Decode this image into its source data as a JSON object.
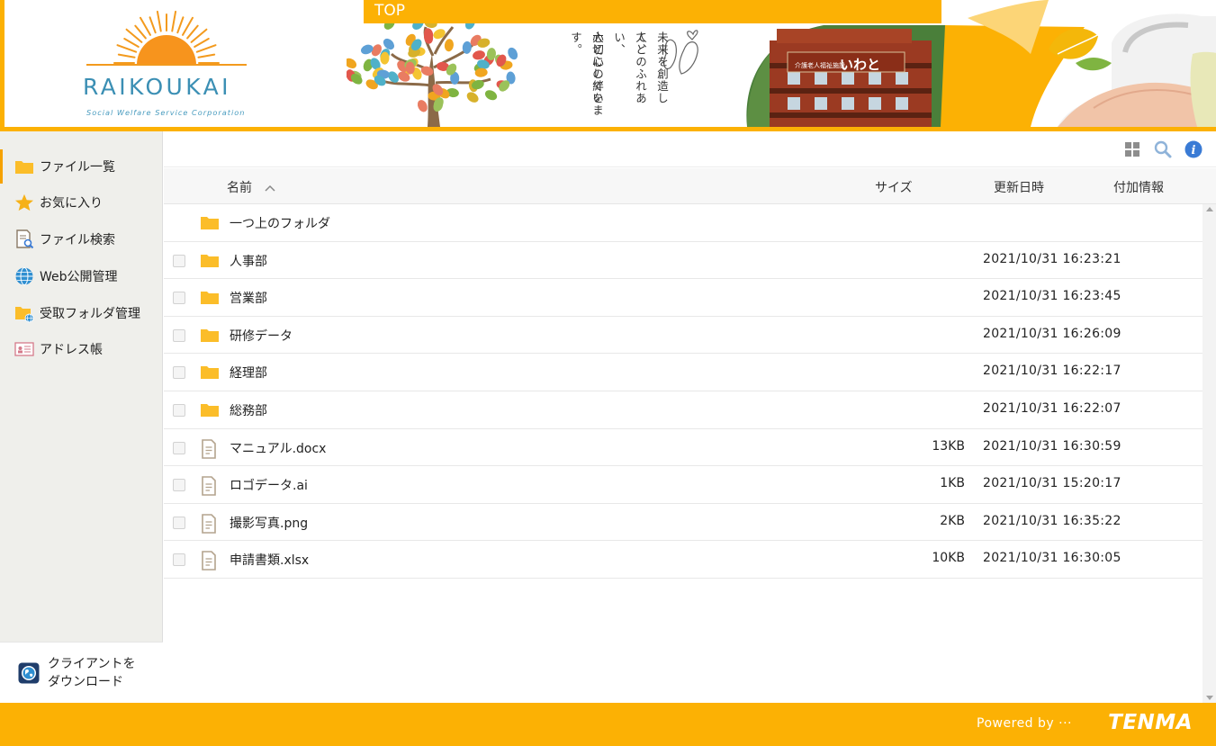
{
  "header": {
    "logo_text": "RAIKOUKAI",
    "logo_subtitle": "Social Welfare Service Corporation",
    "top_label": "TOP",
    "banner_lines": [
      "未来を創造して、",
      "人とのふれあい、",
      "心と心の絆を",
      "大切にしています。"
    ],
    "building_sign": "いわと",
    "building_sign_small": "介護老人福祉施設"
  },
  "sidebar": {
    "items": [
      {
        "label": "ファイル一覧",
        "icon": "folder-icon"
      },
      {
        "label": "お気に入り",
        "icon": "star-icon"
      },
      {
        "label": "ファイル検索",
        "icon": "file-search-icon"
      },
      {
        "label": "Web公開管理",
        "icon": "globe-icon"
      },
      {
        "label": "受取フォルダ管理",
        "icon": "folder-globe-icon"
      },
      {
        "label": "アドレス帳",
        "icon": "address-card-icon"
      }
    ],
    "client_download": {
      "line1": "クライアントを",
      "line2": "ダウンロード"
    }
  },
  "list": {
    "columns": {
      "name": "名前",
      "size": "サイズ",
      "modified": "更新日時",
      "info": "付加情報"
    },
    "parent_folder": "一つ上のフォルダ",
    "rows": [
      {
        "name": "人事部",
        "type": "folder",
        "size": "",
        "date": "2021/10/31 16:23:21"
      },
      {
        "name": "営業部",
        "type": "folder",
        "size": "",
        "date": "2021/10/31 16:23:45"
      },
      {
        "name": "研修データ",
        "type": "folder",
        "size": "",
        "date": "2021/10/31 16:26:09"
      },
      {
        "name": "経理部",
        "type": "folder",
        "size": "",
        "date": "2021/10/31 16:22:17"
      },
      {
        "name": "総務部",
        "type": "folder",
        "size": "",
        "date": "2021/10/31 16:22:07"
      },
      {
        "name": "マニュアル.docx",
        "type": "file",
        "size": "13KB",
        "date": "2021/10/31 16:30:59"
      },
      {
        "name": "ロゴデータ.ai",
        "type": "file",
        "size": "1KB",
        "date": "2021/10/31 15:20:17"
      },
      {
        "name": "撮影写真.png",
        "type": "file",
        "size": "2KB",
        "date": "2021/10/31 16:35:22"
      },
      {
        "name": "申請書類.xlsx",
        "type": "file",
        "size": "10KB",
        "date": "2021/10/31 16:30:05"
      }
    ]
  },
  "footer": {
    "powered_by": "Powered by ···",
    "brand": "TENMA"
  },
  "colors": {
    "accent": "#fcb104",
    "folder": "#fbbd29",
    "logo_blue": "#3b8fb4",
    "info_blue": "#3a7bd5"
  }
}
